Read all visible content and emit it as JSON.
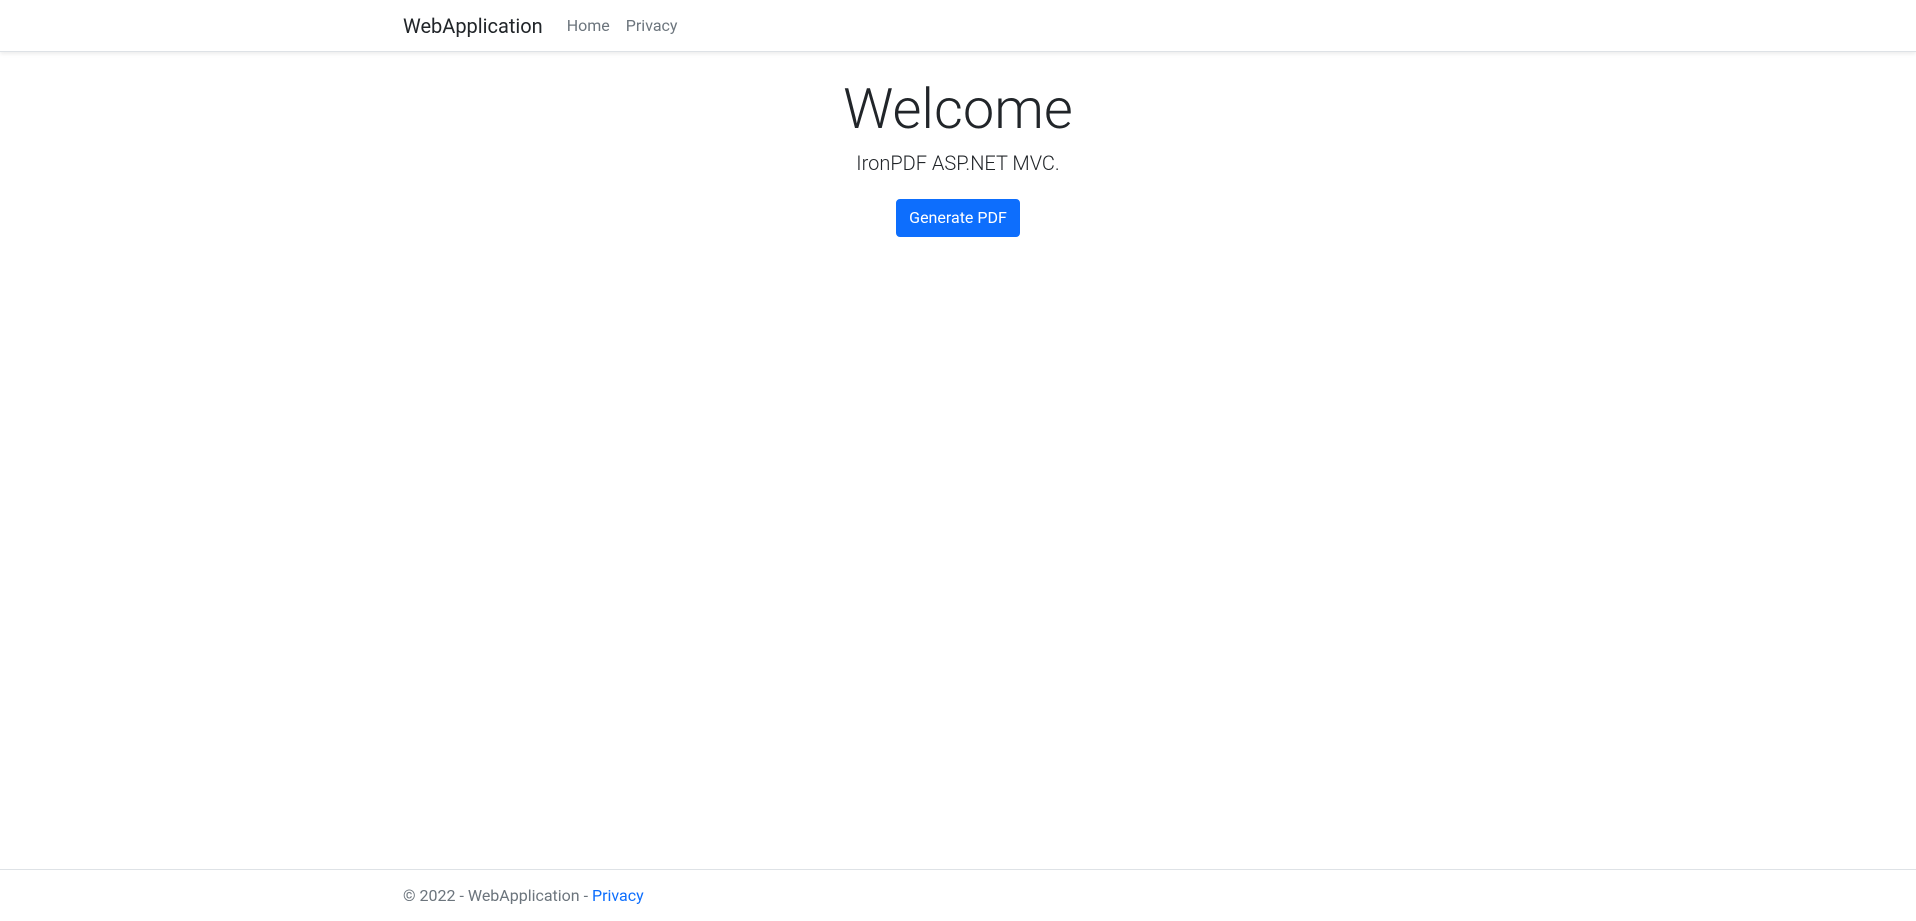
{
  "navbar": {
    "brand": "WebApplication",
    "items": [
      {
        "label": "Home"
      },
      {
        "label": "Privacy"
      }
    ]
  },
  "main": {
    "heading": "Welcome",
    "subheading": "IronPDF ASP.NET MVC.",
    "button_label": "Generate PDF"
  },
  "footer": {
    "copyright_prefix": "© 2022 - WebApplication - ",
    "privacy_label": "Privacy"
  }
}
